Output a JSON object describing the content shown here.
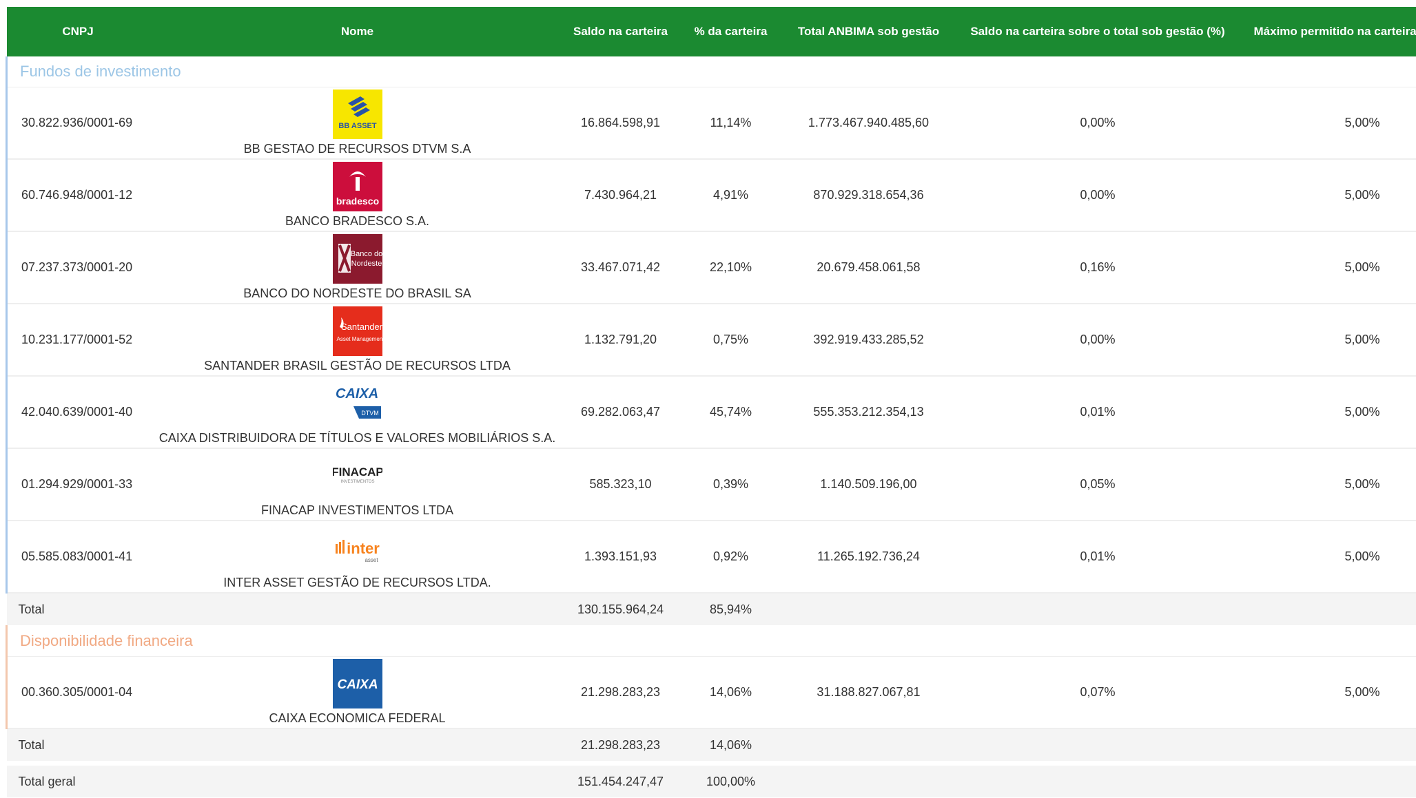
{
  "header": {
    "cnpj": "CNPJ",
    "nome": "Nome",
    "saldo": "Saldo na carteira",
    "pct": "% da carteira",
    "total_anbima": "Total ANBIMA sob gestão",
    "saldo_sobre": "Saldo na carteira sobre o total sob gestão (%)",
    "maximo": "Máximo permitido na carteira"
  },
  "fundos": {
    "title": "Fundos de investimento",
    "rows": [
      {
        "cnpj": "30.822.936/0001-69",
        "nome": "BB GESTAO DE RECURSOS DTVM S.A",
        "logo_text": "BB ASSET",
        "saldo": "16.864.598,91",
        "pct": "11,14%",
        "total": "1.773.467.940.485,60",
        "sobre": "0,00%",
        "max": "5,00%"
      },
      {
        "cnpj": "60.746.948/0001-12",
        "nome": "BANCO BRADESCO S.A.",
        "logo_text": "bradesco",
        "saldo": "7.430.964,21",
        "pct": "4,91%",
        "total": "870.929.318.654,36",
        "sobre": "0,00%",
        "max": "5,00%"
      },
      {
        "cnpj": "07.237.373/0001-20",
        "nome": "BANCO DO NORDESTE DO BRASIL SA",
        "logo_text": "Banco do Nordeste",
        "saldo": "33.467.071,42",
        "pct": "22,10%",
        "total": "20.679.458.061,58",
        "sobre": "0,16%",
        "max": "5,00%"
      },
      {
        "cnpj": "10.231.177/0001-52",
        "nome": "SANTANDER BRASIL GESTÃO DE RECURSOS LTDA",
        "logo_text": "Santander Asset Management",
        "saldo": "1.132.791,20",
        "pct": "0,75%",
        "total": "392.919.433.285,52",
        "sobre": "0,00%",
        "max": "5,00%"
      },
      {
        "cnpj": "42.040.639/0001-40",
        "nome": "CAIXA DISTRIBUIDORA DE TÍTULOS E VALORES MOBILIÁRIOS S.A.",
        "logo_text": "CAIXA DTVM",
        "saldo": "69.282.063,47",
        "pct": "45,74%",
        "total": "555.353.212.354,13",
        "sobre": "0,01%",
        "max": "5,00%"
      },
      {
        "cnpj": "01.294.929/0001-33",
        "nome": "FINACAP INVESTIMENTOS LTDA",
        "logo_text": "FINACAP INVESTIMENTOS",
        "saldo": "585.323,10",
        "pct": "0,39%",
        "total": "1.140.509.196,00",
        "sobre": "0,05%",
        "max": "5,00%"
      },
      {
        "cnpj": "05.585.083/0001-41",
        "nome": "INTER ASSET GESTÃO DE RECURSOS LTDA.",
        "logo_text": "inter asset",
        "saldo": "1.393.151,93",
        "pct": "0,92%",
        "total": "11.265.192.736,24",
        "sobre": "0,01%",
        "max": "5,00%"
      }
    ],
    "total": {
      "label": "Total",
      "saldo": "130.155.964,24",
      "pct": "85,94%"
    }
  },
  "disponibilidade": {
    "title": "Disponibilidade financeira",
    "rows": [
      {
        "cnpj": "00.360.305/0001-04",
        "nome": "CAIXA ECONOMICA FEDERAL",
        "logo_text": "CAIXA",
        "saldo": "21.298.283,23",
        "pct": "14,06%",
        "total": "31.188.827.067,81",
        "sobre": "0,07%",
        "max": "5,00%"
      }
    ],
    "total": {
      "label": "Total",
      "saldo": "21.298.283,23",
      "pct": "14,06%"
    }
  },
  "total_geral": {
    "label": "Total geral",
    "saldo": "151.454.247,47",
    "pct": "100,00%"
  },
  "colors": {
    "header_bg": "#1b8a31",
    "fundos_title": "#9cc6e6",
    "disp_title": "#f1a983"
  }
}
